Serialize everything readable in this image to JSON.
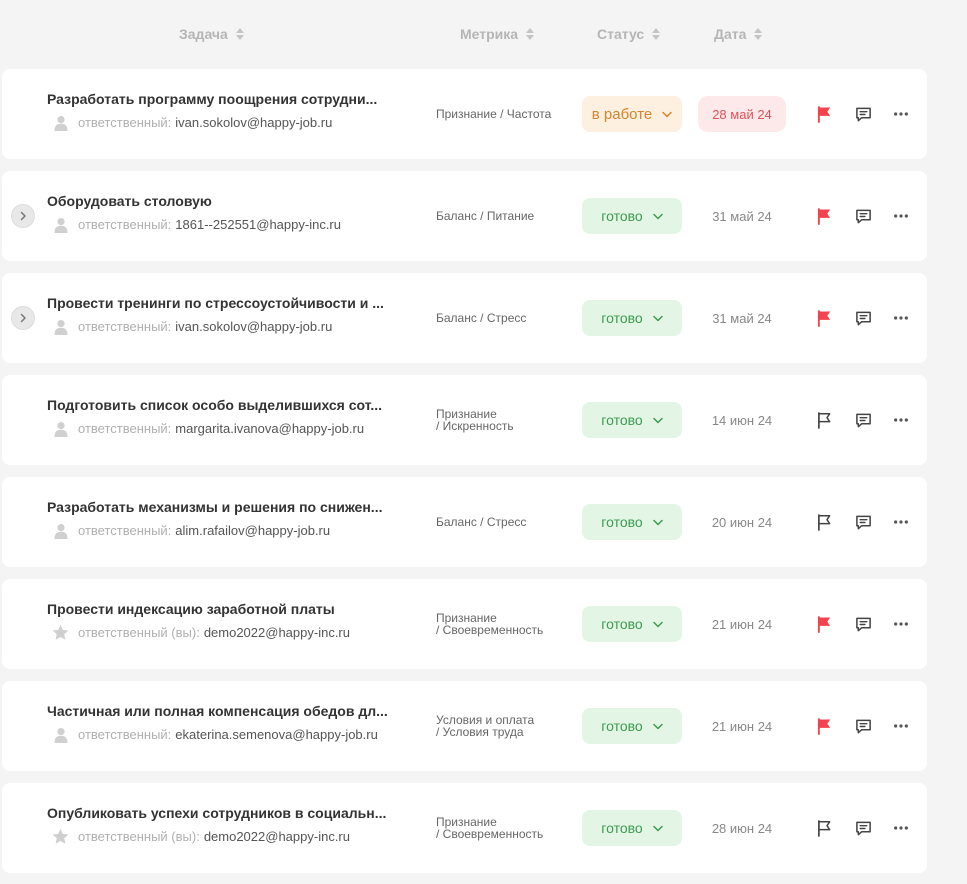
{
  "header": {
    "task": "Задача",
    "metric": "Метрика",
    "status": "Статус",
    "date": "Дата"
  },
  "colors": {
    "done_bg": "#e3f6e5",
    "done_text": "#3e9b52",
    "work_bg": "#fdf0e0",
    "work_text": "#d7832d",
    "overdue_bg": "#fde9ea",
    "flag_red": "#f2444f"
  },
  "tasks": [
    {
      "title": "Разработать программу поощрения сотрудни...",
      "assignee_label": "ответственный:",
      "assignee_email": "ivan.sokolov@happy-job.ru",
      "assignee_icon": "user-icon",
      "expandable": false,
      "metric_line1": "Признание / Частота",
      "metric_line2": "",
      "status": "в работе",
      "status_type": "work",
      "date": "28 май 24",
      "overdue": true,
      "flagged": true
    },
    {
      "title": "Оборудовать столовую",
      "assignee_label": "ответственный:",
      "assignee_email": "1861--252551@happy-inc.ru",
      "assignee_icon": "user-icon",
      "expandable": true,
      "metric_line1": "Баланс / Питание",
      "metric_line2": "",
      "status": "готово",
      "status_type": "done",
      "date": "31 май 24",
      "overdue": false,
      "flagged": true
    },
    {
      "title": "Провести тренинги по стрессоустойчивости и ...",
      "assignee_label": "ответственный:",
      "assignee_email": "ivan.sokolov@happy-job.ru",
      "assignee_icon": "user-icon",
      "expandable": true,
      "metric_line1": "Баланс / Стресс",
      "metric_line2": "",
      "status": "готово",
      "status_type": "done",
      "date": "31 май 24",
      "overdue": false,
      "flagged": true
    },
    {
      "title": "Подготовить список особо выделившихся сот...",
      "assignee_label": "ответственный:",
      "assignee_email": "margarita.ivanova@happy-job.ru",
      "assignee_icon": "user-icon",
      "expandable": false,
      "metric_line1": "Признание",
      "metric_line2": "/ Искренность",
      "status": "готово",
      "status_type": "done",
      "date": "14 июн 24",
      "overdue": false,
      "flagged": false
    },
    {
      "title": "Разработать механизмы и решения по снижен...",
      "assignee_label": "ответственный:",
      "assignee_email": "alim.rafailov@happy-job.ru",
      "assignee_icon": "user-icon",
      "expandable": false,
      "metric_line1": "Баланс / Стресс",
      "metric_line2": "",
      "status": "готово",
      "status_type": "done",
      "date": "20 июн 24",
      "overdue": false,
      "flagged": false
    },
    {
      "title": "Провести индексацию заработной платы",
      "assignee_label": "ответственный (вы):",
      "assignee_email": "demo2022@happy-inc.ru",
      "assignee_icon": "star-icon",
      "expandable": false,
      "metric_line1": "Признание",
      "metric_line2": "/ Своевременность",
      "status": "готово",
      "status_type": "done",
      "date": "21 июн 24",
      "overdue": false,
      "flagged": true
    },
    {
      "title": "Частичная или полная компенсация обедов дл...",
      "assignee_label": "ответственный:",
      "assignee_email": "ekaterina.semenova@happy-job.ru",
      "assignee_icon": "user-icon",
      "expandable": false,
      "metric_line1": "Условия и оплата",
      "metric_line2": "/ Условия труда",
      "status": "готово",
      "status_type": "done",
      "date": "21 июн 24",
      "overdue": false,
      "flagged": true
    },
    {
      "title": "Опубликовать успехи сотрудников в социальн...",
      "assignee_label": "ответственный (вы):",
      "assignee_email": "demo2022@happy-inc.ru",
      "assignee_icon": "star-icon",
      "expandable": false,
      "metric_line1": "Признание",
      "metric_line2": "/ Своевременность",
      "status": "готово",
      "status_type": "done",
      "date": "28 июн 24",
      "overdue": false,
      "flagged": false
    }
  ]
}
